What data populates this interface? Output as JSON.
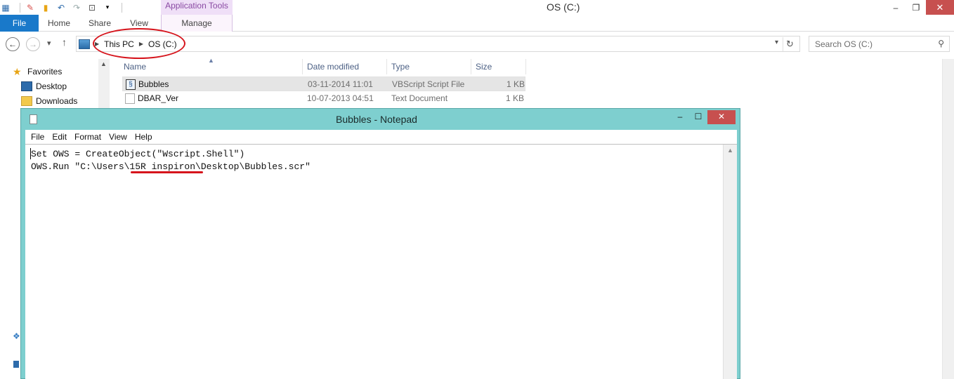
{
  "explorer": {
    "window_title": "OS (C:)",
    "context_tab_group": "Application Tools",
    "window_controls": {
      "minimize": "–",
      "maximize": "❐",
      "close": "✕"
    },
    "ribbon_tabs": {
      "file": "File",
      "home": "Home",
      "share": "Share",
      "view": "View",
      "manage": "Manage"
    },
    "breadcrumb": [
      "This PC",
      "OS (C:)"
    ],
    "search": {
      "placeholder": "Search OS (C:)"
    },
    "nav_pane": {
      "favorites": "Favorites",
      "desktop": "Desktop",
      "downloads": "Downloads"
    },
    "file_list": {
      "columns": {
        "name": "Name",
        "date": "Date modified",
        "type": "Type",
        "size": "Size"
      },
      "rows": [
        {
          "name": "Bubbles",
          "date": "03-11-2014 11:01",
          "type": "VBScript Script File",
          "size": "1 KB"
        },
        {
          "name": "DBAR_Ver",
          "date": "10-07-2013 04:51",
          "type": "Text Document",
          "size": "1 KB"
        }
      ]
    }
  },
  "notepad": {
    "title": "Bubbles - Notepad",
    "controls": {
      "minimize": "–",
      "maximize": "☐",
      "close": "✕"
    },
    "menu": {
      "file": "File",
      "edit": "Edit",
      "format": "Format",
      "view": "View",
      "help": "Help"
    },
    "content": "Set OWS = CreateObject(\"Wscript.Shell\")\nOWS.Run \"C:\\Users\\15R inspiron\\Desktop\\Bubbles.scr\""
  },
  "annotations": {
    "highlight_color": "#d6141c"
  }
}
